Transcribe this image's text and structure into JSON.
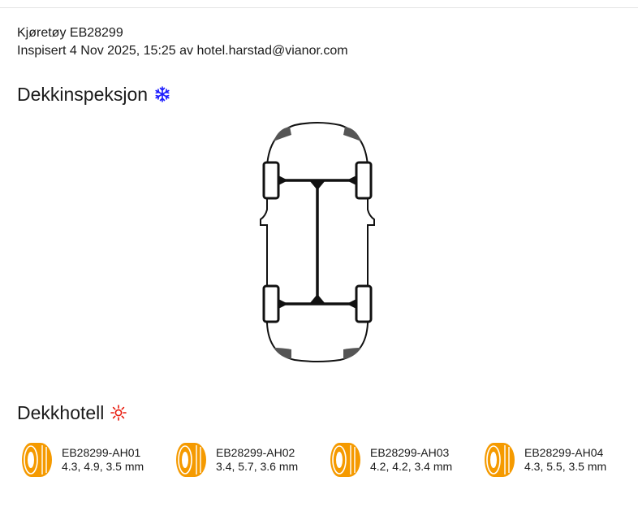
{
  "vehicle": {
    "title": "Kjøretøy EB28299",
    "inspected": "Inspisert 4 Nov 2025, 15:25 av hotel.harstad@vianor.com"
  },
  "inspection": {
    "heading": "Dekkinspeksjon",
    "season_icon": "snowflake-icon",
    "season_color": "#1a1aff"
  },
  "hotel": {
    "heading": "Dekkhotell",
    "season_icon": "sun-icon",
    "season_color": "#e8190c",
    "tire_color": "#f59a00",
    "tires": [
      {
        "id": "EB28299-AH01",
        "depths": "4.3, 4.9, 3.5 mm"
      },
      {
        "id": "EB28299-AH02",
        "depths": "3.4, 5.7, 3.6 mm"
      },
      {
        "id": "EB28299-AH03",
        "depths": "4.2, 4.2, 3.4 mm"
      },
      {
        "id": "EB28299-AH04",
        "depths": "4.3, 5.5, 3.5 mm"
      }
    ]
  }
}
